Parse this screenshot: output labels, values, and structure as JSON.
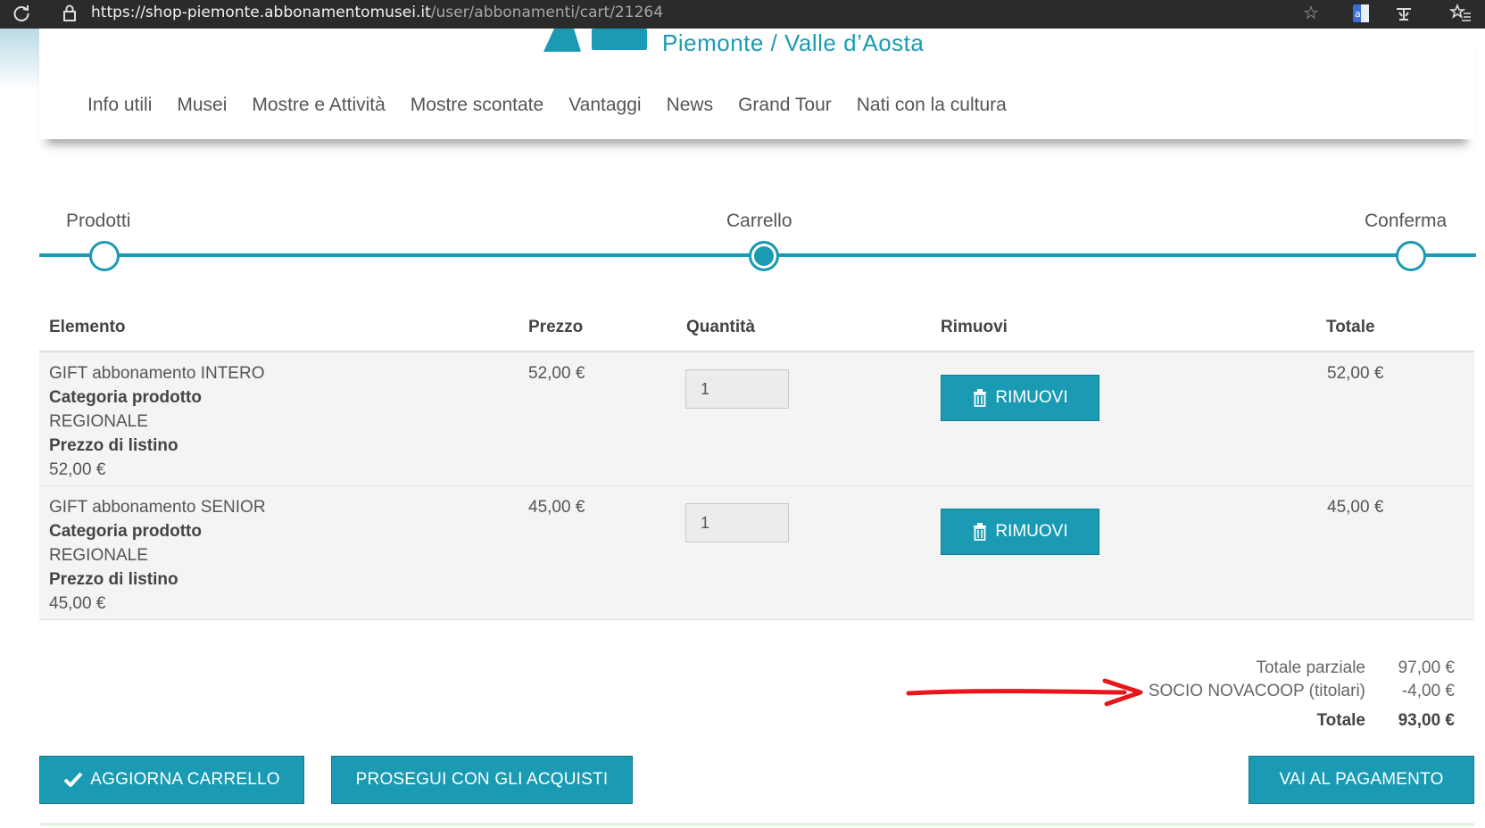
{
  "browser": {
    "url_host": "https://shop-piemonte.abbonamentomusei.it",
    "url_path": "/user/abbonamenti/cart/21264"
  },
  "header": {
    "brand": "Piemonte / Valle d’Aosta",
    "nav": [
      "Info utili",
      "Musei",
      "Mostre e Attività",
      "Mostre scontate",
      "Vantaggi",
      "News",
      "Grand Tour",
      "Nati con la cultura"
    ]
  },
  "stepper": {
    "steps": [
      "Prodotti",
      "Carrello",
      "Conferma"
    ],
    "active": "Carrello"
  },
  "table": {
    "headers": {
      "item": "Elemento",
      "price": "Prezzo",
      "qty": "Quantità",
      "remove": "Rimuovi",
      "total": "Totale"
    },
    "rows": [
      {
        "name": "GIFT abbonamento INTERO",
        "category_label": "Categoria prodotto",
        "category": "REGIONALE",
        "list_label": "Prezzo di listino",
        "list_price": "52,00 €",
        "price": "52,00 €",
        "qty": "1",
        "remove": "RIMUOVI",
        "total": "52,00 €"
      },
      {
        "name": "GIFT abbonamento SENIOR",
        "category_label": "Categoria prodotto",
        "category": "REGIONALE",
        "list_label": "Prezzo di listino",
        "list_price": "45,00 €",
        "price": "45,00 €",
        "qty": "1",
        "remove": "RIMUOVI",
        "total": "45,00 €"
      }
    ]
  },
  "summary": {
    "subtotal_label": "Totale parziale",
    "subtotal": "97,00 €",
    "discount_label": "SOCIO NOVACOOP (titolari)",
    "discount": "-4,00 €",
    "total_label": "Totale",
    "total": "93,00 €"
  },
  "buttons": {
    "update": "AGGIORNA CARRELLO",
    "continue": "PROSEGUI CON GLI ACQUISTI",
    "pay": "VAI AL PAGAMENTO"
  },
  "colors": {
    "accent": "#1a9bb3",
    "annotation": "#e8161b"
  }
}
